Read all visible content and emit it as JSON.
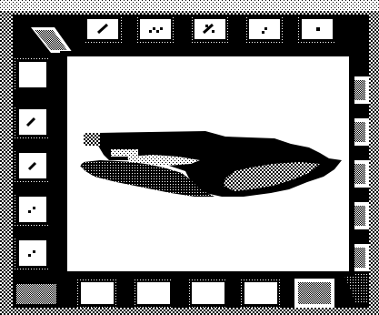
{
  "screen": {
    "colors": {
      "ink": "#000000",
      "paper": "#ffffff"
    }
  },
  "top_bar": {
    "buttons": [
      {
        "icon": "slash-icon"
      },
      {
        "icon": "dots-diagonal-icon"
      },
      {
        "icon": "slash-dots-icon"
      },
      {
        "icon": "dot-small-icon"
      },
      {
        "icon": "dot-icon"
      }
    ]
  },
  "left_bar": {
    "buttons": [
      {
        "icon": "blank-icon"
      },
      {
        "icon": "slash-icon"
      },
      {
        "icon": "slash-icon"
      },
      {
        "icon": "double-dot-icon"
      },
      {
        "icon": "double-dot-icon"
      }
    ]
  },
  "right_bar": {
    "buttons": [
      {
        "icon": "gray-block-icon"
      },
      {
        "icon": "gray-block-icon"
      },
      {
        "icon": "gray-block-icon"
      },
      {
        "icon": "gray-block-icon"
      },
      {
        "icon": "gray-block-icon"
      }
    ]
  },
  "bottom_bar": {
    "buttons": [
      {
        "icon": "blank-icon"
      },
      {
        "icon": "blank-icon"
      },
      {
        "icon": "blank-icon"
      },
      {
        "icon": "blank-icon"
      },
      {
        "icon": "gray-block-icon"
      }
    ]
  },
  "canvas": {
    "content": "dithered-ship-silhouette"
  }
}
